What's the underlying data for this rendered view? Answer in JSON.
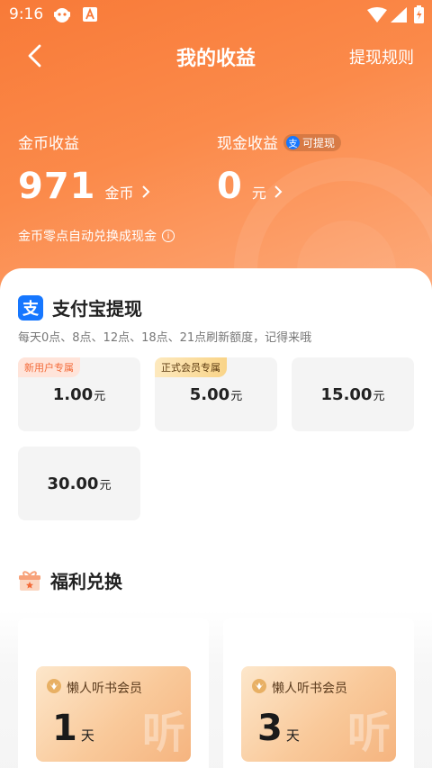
{
  "status_bar": {
    "time": "9:16"
  },
  "header": {
    "title": "我的收益",
    "rules_link": "提现规则"
  },
  "earnings": {
    "coin": {
      "label": "金币收益",
      "value": "971",
      "unit": "金币"
    },
    "cash": {
      "label": "现金收益",
      "badge": "可提现",
      "badge_icon": "支",
      "value": "0",
      "unit": "元"
    },
    "exchange_note": "金币零点自动兑换成现金",
    "info_icon": "i"
  },
  "alipay": {
    "logo": "支",
    "title": "支付宝提现",
    "refresh_note": "每天0点、8点、12点、18点、21点刷新额度，记得来哦",
    "amounts": [
      {
        "value": "1.00",
        "unit": "元",
        "tag": "新用户专属"
      },
      {
        "value": "5.00",
        "unit": "元",
        "tag": "正式会员专属"
      },
      {
        "value": "15.00",
        "unit": "元",
        "tag": ""
      },
      {
        "value": "30.00",
        "unit": "元",
        "tag": ""
      }
    ]
  },
  "welfare": {
    "title": "福利兑换",
    "cards": [
      {
        "name": "懒人听书会员",
        "days": "1",
        "unit": "天",
        "watermark": "听"
      },
      {
        "name": "懒人听书会员",
        "days": "3",
        "unit": "天",
        "watermark": "听"
      }
    ]
  },
  "colors": {
    "accent": "#f87a38",
    "alipay_blue": "#1677ff"
  }
}
